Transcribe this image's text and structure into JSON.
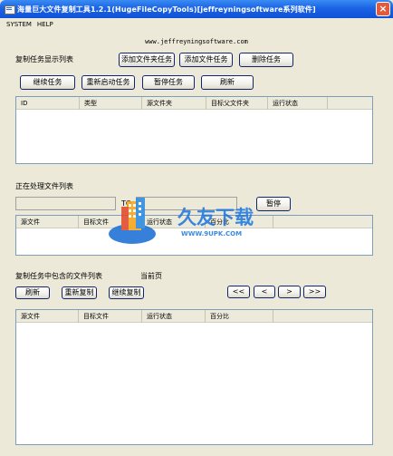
{
  "window": {
    "title": "海量巨大文件复制工具1.2.1(HugeFileCopyTools)[jeffreyningsoftware系列软件]",
    "close_glyph": "×"
  },
  "menu": {
    "items": [
      "SYSTEM",
      "HELP"
    ]
  },
  "site_url": "www.jeffreyningsoftware.com",
  "tasks": {
    "label": "复制任务显示列表",
    "add_folder_task": "添加文件夹任务",
    "add_file_task": "添加文件任务",
    "delete_task": "删除任务",
    "continue_task": "继续任务",
    "restart_task": "重新启动任务",
    "pause_task": "暂停任务",
    "refresh": "刷新",
    "columns": [
      "ID",
      "类型",
      "源文件夹",
      "目标父文件夹",
      "运行状态"
    ]
  },
  "processing": {
    "label": "正在处理文件列表",
    "to_label": "TO",
    "source_value": "",
    "target_value": "",
    "pause": "暂停",
    "columns": [
      "源文件",
      "目标文件",
      "运行状态",
      "百分比"
    ]
  },
  "files": {
    "label": "复制任务中包含的文件列表",
    "current_page_label": "当前页",
    "refresh": "刷新",
    "recopy": "重新复制",
    "continue_copy": "继续复制",
    "nav": [
      "<<",
      "<",
      ">",
      ">>"
    ],
    "columns": [
      "源文件",
      "目标文件",
      "运行状态",
      "百分比"
    ]
  },
  "watermark": {
    "brand": "久友下载",
    "url": "WWW.9UPK.COM"
  }
}
